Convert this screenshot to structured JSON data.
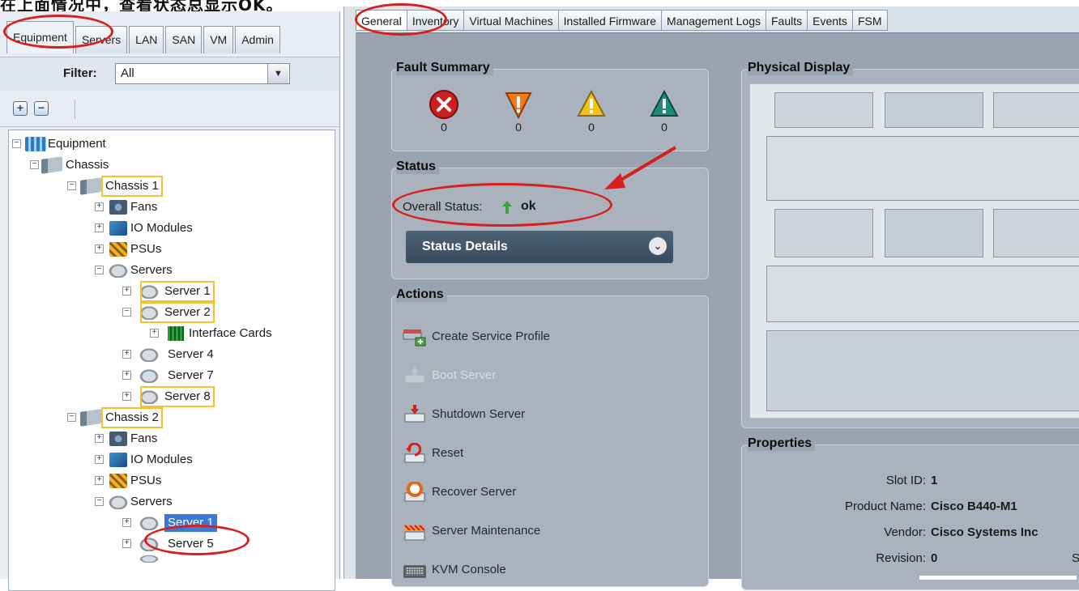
{
  "caption": "在上面情况中，查看状态总显示OK。",
  "nav_tabs": [
    "Equipment",
    "Servers",
    "LAN",
    "SAN",
    "VM",
    "Admin"
  ],
  "filter": {
    "label": "Filter:",
    "value": "All"
  },
  "tree": {
    "root": "Equipment",
    "chassis_group": "Chassis",
    "chassis1": "Chassis 1",
    "fans": "Fans",
    "io_modules": "IO Modules",
    "psus": "PSUs",
    "servers": "Servers",
    "server1": "Server 1",
    "server2": "Server 2",
    "interface_cards": "Interface Cards",
    "server4": "Server 4",
    "server7": "Server 7",
    "server8": "Server 8",
    "chassis2": "Chassis 2",
    "server5": "Server 5"
  },
  "tabs": [
    "General",
    "Inventory",
    "Virtual Machines",
    "Installed Firmware",
    "Management Logs",
    "Faults",
    "Events",
    "FSM"
  ],
  "fault_summary": {
    "title": "Fault Summary",
    "counts": [
      "0",
      "0",
      "0",
      "0"
    ],
    "colors": {
      "critical": "#cc1f1f",
      "major": "#f07a1a",
      "minor": "#f2c31a",
      "warning": "#1f8a7a"
    }
  },
  "status": {
    "title": "Status",
    "overall_label": "Overall Status:",
    "overall_value": "ok",
    "details_label": "Status Details"
  },
  "actions": {
    "title": "Actions",
    "items": [
      "Create Service Profile",
      "Boot Server",
      "Shutdown Server",
      "Reset",
      "Recover Server",
      "Server Maintenance",
      "KVM Console"
    ]
  },
  "physical_display": {
    "title": "Physical Display"
  },
  "properties": {
    "title": "Properties",
    "rows": [
      {
        "key": "Slot ID:",
        "value": "1"
      },
      {
        "key": "Product Name:",
        "value": "Cisco B440-M1"
      },
      {
        "key": "Vendor:",
        "value": "Cisco Systems Inc"
      },
      {
        "key": "Revision:",
        "value": "0"
      }
    ],
    "cut_text": "S"
  },
  "accent": {
    "callout": "#d62020",
    "highlight": "#f2c230",
    "selection": "#3a79d6"
  }
}
